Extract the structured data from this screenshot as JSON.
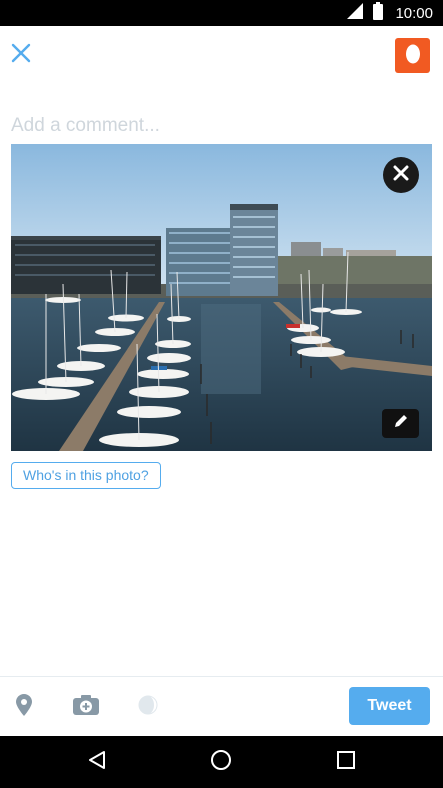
{
  "status_bar": {
    "time": "10:00",
    "icons": [
      "signal-icon",
      "battery-icon"
    ]
  },
  "header": {
    "close_icon": "close-icon",
    "avatar_icon": "egg-avatar-icon"
  },
  "compose": {
    "placeholder": "Add a comment...",
    "value": ""
  },
  "photo": {
    "remove_icon": "close-icon",
    "edit_icon": "pencil-icon",
    "tag_label": "Who's in this photo?"
  },
  "toolbar": {
    "location_icon": "location-pin-icon",
    "camera_icon": "camera-add-icon",
    "theme_icon": "half-moon-icon",
    "tweet_label": "Tweet"
  },
  "nav_bar": {
    "back_icon": "back-triangle-icon",
    "home_icon": "home-circle-icon",
    "recents_icon": "recents-square-icon"
  },
  "colors": {
    "accent": "#55acee",
    "avatar_bg": "#f15a22",
    "placeholder": "#cfd6dc",
    "icon_gray": "#8899a6"
  }
}
